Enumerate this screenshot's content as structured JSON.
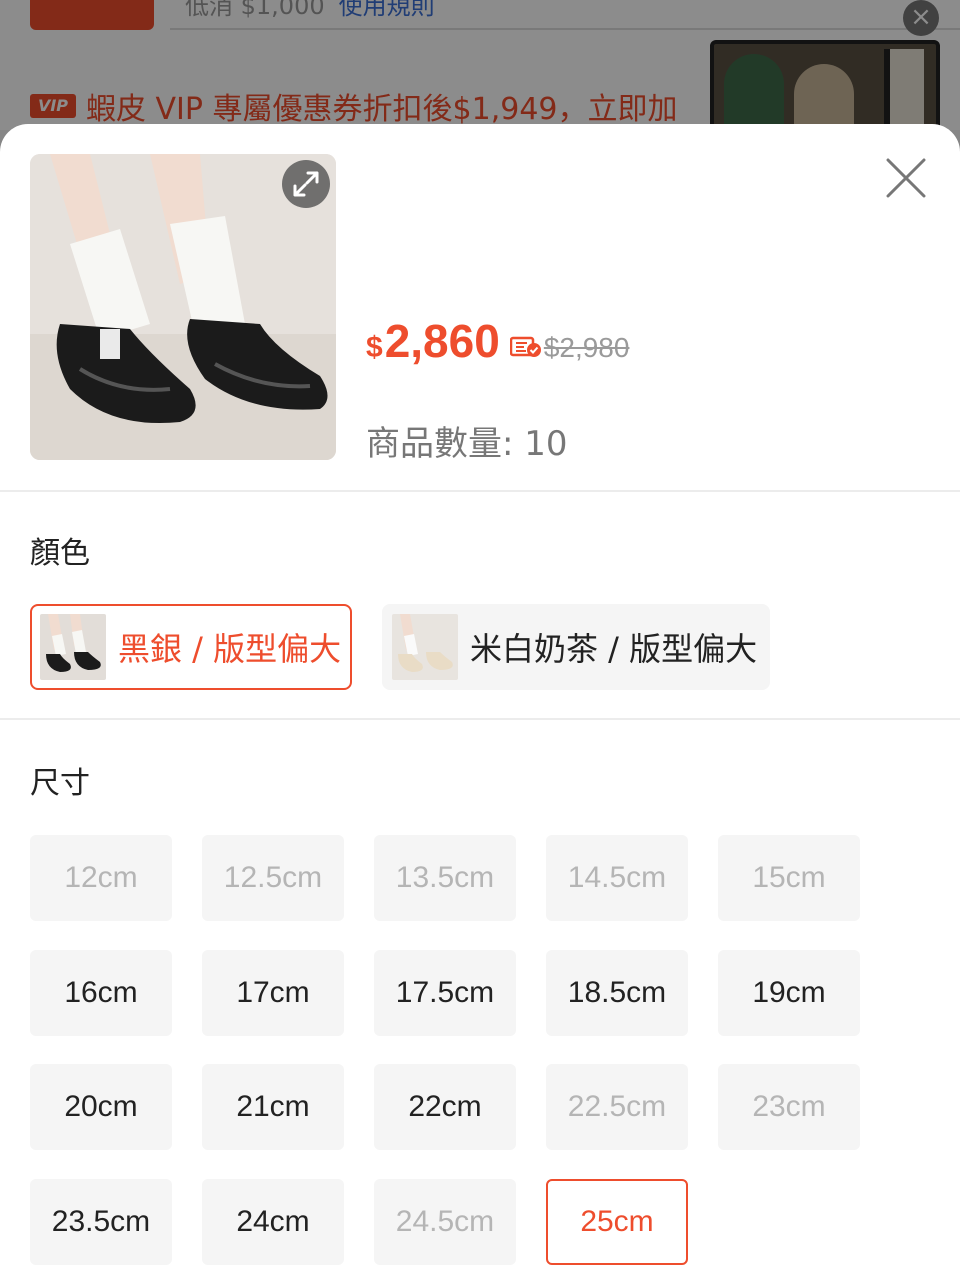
{
  "background": {
    "faded_text": "低消 $1,000",
    "faded_link": "使用規則",
    "vip_badge": "VIP",
    "vip_promo": "蝦皮 VIP 專屬優惠券折扣後$1,949，立即加"
  },
  "product": {
    "price_currency": "$",
    "price": "2,860",
    "original_price": "$2,980",
    "stock_label": "商品數量: 10"
  },
  "color_section": {
    "title": "顏色",
    "options": [
      {
        "label": "黑銀 / 版型偏大",
        "state": "selected"
      },
      {
        "label": "米白奶茶 / 版型偏大",
        "state": "normal"
      }
    ]
  },
  "size_section": {
    "title": "尺寸",
    "options": [
      {
        "label": "12cm",
        "state": "disabled"
      },
      {
        "label": "12.5cm",
        "state": "disabled"
      },
      {
        "label": "13.5cm",
        "state": "disabled"
      },
      {
        "label": "14.5cm",
        "state": "disabled"
      },
      {
        "label": "15cm",
        "state": "disabled"
      },
      {
        "label": "16cm",
        "state": "available"
      },
      {
        "label": "17cm",
        "state": "available"
      },
      {
        "label": "17.5cm",
        "state": "available"
      },
      {
        "label": "18.5cm",
        "state": "available"
      },
      {
        "label": "19cm",
        "state": "available"
      },
      {
        "label": "20cm",
        "state": "available"
      },
      {
        "label": "21cm",
        "state": "available"
      },
      {
        "label": "22cm",
        "state": "available"
      },
      {
        "label": "22.5cm",
        "state": "disabled"
      },
      {
        "label": "23cm",
        "state": "disabled"
      },
      {
        "label": "23.5cm",
        "state": "available"
      },
      {
        "label": "24cm",
        "state": "available"
      },
      {
        "label": "24.5cm",
        "state": "disabled"
      },
      {
        "label": "25cm",
        "state": "selected"
      }
    ]
  },
  "colors": {
    "accent": "#ee4d2d",
    "disabled_text": "#b5b5b5",
    "chip_bg": "#f5f5f5"
  }
}
